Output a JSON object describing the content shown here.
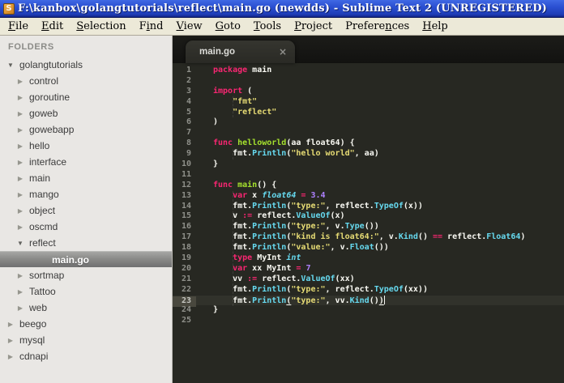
{
  "window": {
    "title": "F:\\kanbox\\golangtutorials\\reflect\\main.go (newdds) - Sublime Text 2 (UNREGISTERED)",
    "app_icon_letter": "S"
  },
  "menus": [
    {
      "pre": "",
      "key": "F",
      "post": "ile"
    },
    {
      "pre": "",
      "key": "E",
      "post": "dit"
    },
    {
      "pre": "",
      "key": "S",
      "post": "election"
    },
    {
      "pre": "F",
      "key": "i",
      "post": "nd"
    },
    {
      "pre": "",
      "key": "V",
      "post": "iew"
    },
    {
      "pre": "",
      "key": "G",
      "post": "oto"
    },
    {
      "pre": "",
      "key": "T",
      "post": "ools"
    },
    {
      "pre": "",
      "key": "P",
      "post": "roject"
    },
    {
      "pre": "Prefere",
      "key": "n",
      "post": "ces"
    },
    {
      "pre": "",
      "key": "H",
      "post": "elp"
    }
  ],
  "sidebar": {
    "header": "FOLDERS",
    "items": [
      {
        "label": "golangtutorials",
        "level": 0,
        "state": "expanded"
      },
      {
        "label": "control",
        "level": 1,
        "state": "collapsed"
      },
      {
        "label": "goroutine",
        "level": 1,
        "state": "collapsed"
      },
      {
        "label": "goweb",
        "level": 1,
        "state": "collapsed"
      },
      {
        "label": "gowebapp",
        "level": 1,
        "state": "collapsed"
      },
      {
        "label": "hello",
        "level": 1,
        "state": "collapsed"
      },
      {
        "label": "interface",
        "level": 1,
        "state": "collapsed"
      },
      {
        "label": "main",
        "level": 1,
        "state": "collapsed"
      },
      {
        "label": "mango",
        "level": 1,
        "state": "collapsed"
      },
      {
        "label": "object",
        "level": 1,
        "state": "collapsed"
      },
      {
        "label": "oscmd",
        "level": 1,
        "state": "collapsed"
      },
      {
        "label": "reflect",
        "level": 1,
        "state": "expanded"
      },
      {
        "label": "main.go",
        "level": 2,
        "state": "",
        "selected": true
      },
      {
        "label": "sortmap",
        "level": 1,
        "state": "collapsed"
      },
      {
        "label": "Tattoo",
        "level": 1,
        "state": "collapsed"
      },
      {
        "label": "web",
        "level": 1,
        "state": "collapsed"
      },
      {
        "label": "beego",
        "level": 0,
        "state": "collapsed"
      },
      {
        "label": "mysql",
        "level": 0,
        "state": "collapsed"
      },
      {
        "label": "cdnapi",
        "level": 0,
        "state": "collapsed"
      }
    ]
  },
  "tab": {
    "label": "main.go",
    "close": "×"
  },
  "theme": {
    "sidebar_bg": "#e9e7e4",
    "editor_bg": "#272822",
    "keyword": "#f92672",
    "function": "#a6e22e",
    "type_call": "#66d9ef",
    "string": "#e6db74",
    "number": "#ae81ff",
    "text": "#f8f8f2",
    "line_number": "#8f908a",
    "current_line": "#31322b",
    "titlebar_blue": "#2b50d2",
    "menubar_bg": "#ece9d8"
  },
  "editor": {
    "lines": [
      {
        "n": 1,
        "t": [
          [
            "k",
            "package"
          ],
          [
            "w",
            " main"
          ]
        ]
      },
      {
        "n": 2,
        "t": []
      },
      {
        "n": 3,
        "t": [
          [
            "k",
            "import"
          ],
          [
            "w",
            " ("
          ]
        ]
      },
      {
        "n": 4,
        "t": [
          [
            "w",
            "    "
          ],
          [
            "s",
            "\"fmt\""
          ]
        ]
      },
      {
        "n": 5,
        "t": [
          [
            "w",
            "    "
          ],
          [
            "s",
            "\"reflect\""
          ]
        ]
      },
      {
        "n": 6,
        "t": [
          [
            "w",
            ")"
          ]
        ]
      },
      {
        "n": 7,
        "t": []
      },
      {
        "n": 8,
        "t": [
          [
            "k",
            "func"
          ],
          [
            "w",
            " "
          ],
          [
            "f",
            "helloworld"
          ],
          [
            "w",
            "(aa float64) {"
          ]
        ]
      },
      {
        "n": 9,
        "t": [
          [
            "w",
            "    fmt."
          ],
          [
            "b",
            "Println"
          ],
          [
            "w",
            "("
          ],
          [
            "s",
            "\"hello world\""
          ],
          [
            "w",
            ", aa)"
          ]
        ]
      },
      {
        "n": 10,
        "t": [
          [
            "w",
            "}"
          ]
        ]
      },
      {
        "n": 11,
        "t": []
      },
      {
        "n": 12,
        "t": [
          [
            "k",
            "func"
          ],
          [
            "w",
            " "
          ],
          [
            "f",
            "main"
          ],
          [
            "w",
            "() {"
          ]
        ]
      },
      {
        "n": 13,
        "t": [
          [
            "w",
            "    "
          ],
          [
            "k",
            "var"
          ],
          [
            "w",
            " x "
          ],
          [
            "bi",
            "float64"
          ],
          [
            "w",
            " "
          ],
          [
            "k",
            "="
          ],
          [
            "w",
            " "
          ],
          [
            "n",
            "3.4"
          ]
        ]
      },
      {
        "n": 14,
        "t": [
          [
            "w",
            "    fmt."
          ],
          [
            "b",
            "Println"
          ],
          [
            "w",
            "("
          ],
          [
            "s",
            "\"type:\""
          ],
          [
            "w",
            ", reflect."
          ],
          [
            "b",
            "TypeOf"
          ],
          [
            "w",
            "(x))"
          ]
        ]
      },
      {
        "n": 15,
        "t": [
          [
            "w",
            "    v "
          ],
          [
            "k",
            ":="
          ],
          [
            "w",
            " reflect."
          ],
          [
            "b",
            "ValueOf"
          ],
          [
            "w",
            "(x)"
          ]
        ]
      },
      {
        "n": 16,
        "t": [
          [
            "w",
            "    fmt."
          ],
          [
            "b",
            "Println"
          ],
          [
            "w",
            "("
          ],
          [
            "s",
            "\"type:\""
          ],
          [
            "w",
            ", v."
          ],
          [
            "b",
            "Type"
          ],
          [
            "w",
            "())"
          ]
        ]
      },
      {
        "n": 17,
        "t": [
          [
            "w",
            "    fmt."
          ],
          [
            "b",
            "Println"
          ],
          [
            "w",
            "("
          ],
          [
            "s",
            "\"kind is float64:\""
          ],
          [
            "w",
            ", v."
          ],
          [
            "b",
            "Kind"
          ],
          [
            "w",
            "() "
          ],
          [
            "k",
            "=="
          ],
          [
            "w",
            " reflect."
          ],
          [
            "b",
            "Float64"
          ],
          [
            "w",
            ")"
          ]
        ]
      },
      {
        "n": 18,
        "t": [
          [
            "w",
            "    fmt."
          ],
          [
            "b",
            "Println"
          ],
          [
            "w",
            "("
          ],
          [
            "s",
            "\"value:\""
          ],
          [
            "w",
            ", v."
          ],
          [
            "b",
            "Float"
          ],
          [
            "w",
            "())"
          ]
        ]
      },
      {
        "n": 19,
        "t": [
          [
            "w",
            "    "
          ],
          [
            "k",
            "type"
          ],
          [
            "w",
            " MyInt "
          ],
          [
            "bi",
            "int"
          ]
        ]
      },
      {
        "n": 20,
        "t": [
          [
            "w",
            "    "
          ],
          [
            "k",
            "var"
          ],
          [
            "w",
            " xx MyInt "
          ],
          [
            "k",
            "="
          ],
          [
            "w",
            " "
          ],
          [
            "n",
            "7"
          ]
        ]
      },
      {
        "n": 21,
        "t": [
          [
            "w",
            "    vv "
          ],
          [
            "k",
            ":="
          ],
          [
            "w",
            " reflect."
          ],
          [
            "b",
            "ValueOf"
          ],
          [
            "w",
            "(xx)"
          ]
        ]
      },
      {
        "n": 22,
        "t": [
          [
            "w",
            "    fmt."
          ],
          [
            "b",
            "Println"
          ],
          [
            "w",
            "("
          ],
          [
            "s",
            "\"type:\""
          ],
          [
            "w",
            ", reflect."
          ],
          [
            "b",
            "TypeOf"
          ],
          [
            "w",
            "(xx))"
          ]
        ]
      },
      {
        "n": 23,
        "current": true,
        "t": [
          [
            "w",
            "    fmt."
          ],
          [
            "b",
            "Println"
          ],
          [
            "u",
            "("
          ],
          [
            "s",
            "\"type:\""
          ],
          [
            "w",
            ", vv."
          ],
          [
            "b",
            "Kind"
          ],
          [
            "w",
            "()"
          ],
          [
            "u",
            ")"
          ],
          [
            "cur",
            ""
          ]
        ]
      },
      {
        "n": 24,
        "t": [
          [
            "w",
            "}"
          ]
        ]
      },
      {
        "n": 25,
        "t": []
      }
    ]
  }
}
